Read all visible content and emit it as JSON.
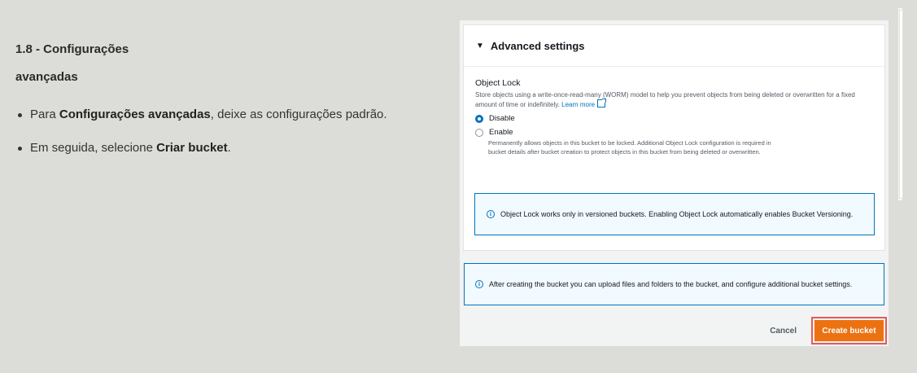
{
  "slide": {
    "title_line1": "1.8 - Configurações",
    "title_line2": "avançadas",
    "bullet1": {
      "pre": "Para ",
      "bold": "Configurações avançadas",
      "post": ", deixe as configurações padrão."
    },
    "bullet2": {
      "pre": "Em seguida, selecione ",
      "bold": "Criar bucket",
      "post": "."
    }
  },
  "console": {
    "advanced_settings": "Advanced settings",
    "object_lock_label": "Object Lock",
    "object_lock_desc": "Store objects using a write-once-read-many (WORM) model to help you prevent objects from being deleted or overwritten for a fixed amount of time or indefinitely.",
    "learn_more": "Learn more",
    "options": [
      {
        "label": "Disable",
        "selected": true
      },
      {
        "label": "Enable",
        "selected": false
      }
    ],
    "enable_desc": "Permanently allows objects in this bucket to be locked. Additional Object Lock configuration is required in bucket details after bucket creation to protect objects in this bucket from being deleted or overwritten.",
    "info_versioning": "Object Lock works only in versioned buckets. Enabling Object Lock automatically enables Bucket Versioning.",
    "info_after_create": "After creating the bucket you can upload files and folders to the bucket, and configure additional bucket settings.",
    "cancel": "Cancel",
    "create_bucket": "Create bucket"
  },
  "colors": {
    "primary_button": "#ec7211",
    "highlight_border": "#e45b5b",
    "link": "#0073bb"
  },
  "icons": [
    "caret-down-icon",
    "external-link-icon",
    "info-icon"
  ]
}
